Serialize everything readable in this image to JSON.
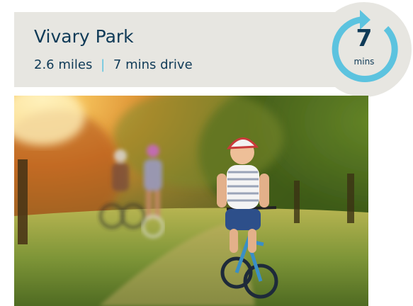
{
  "place": {
    "name": "Vivary Park",
    "distance": "2.6 miles",
    "separator": "|",
    "drive_time": "7 mins drive"
  },
  "badge": {
    "number": "7",
    "unit": "mins",
    "icon": "refresh-arrow-icon",
    "accent_color": "#5cc3df"
  },
  "photo": {
    "subject": "family-cycling-photo"
  },
  "colors": {
    "panel_background": "#e7e6e1",
    "text_primary": "#0f3a57",
    "accent": "#5cc3df"
  }
}
